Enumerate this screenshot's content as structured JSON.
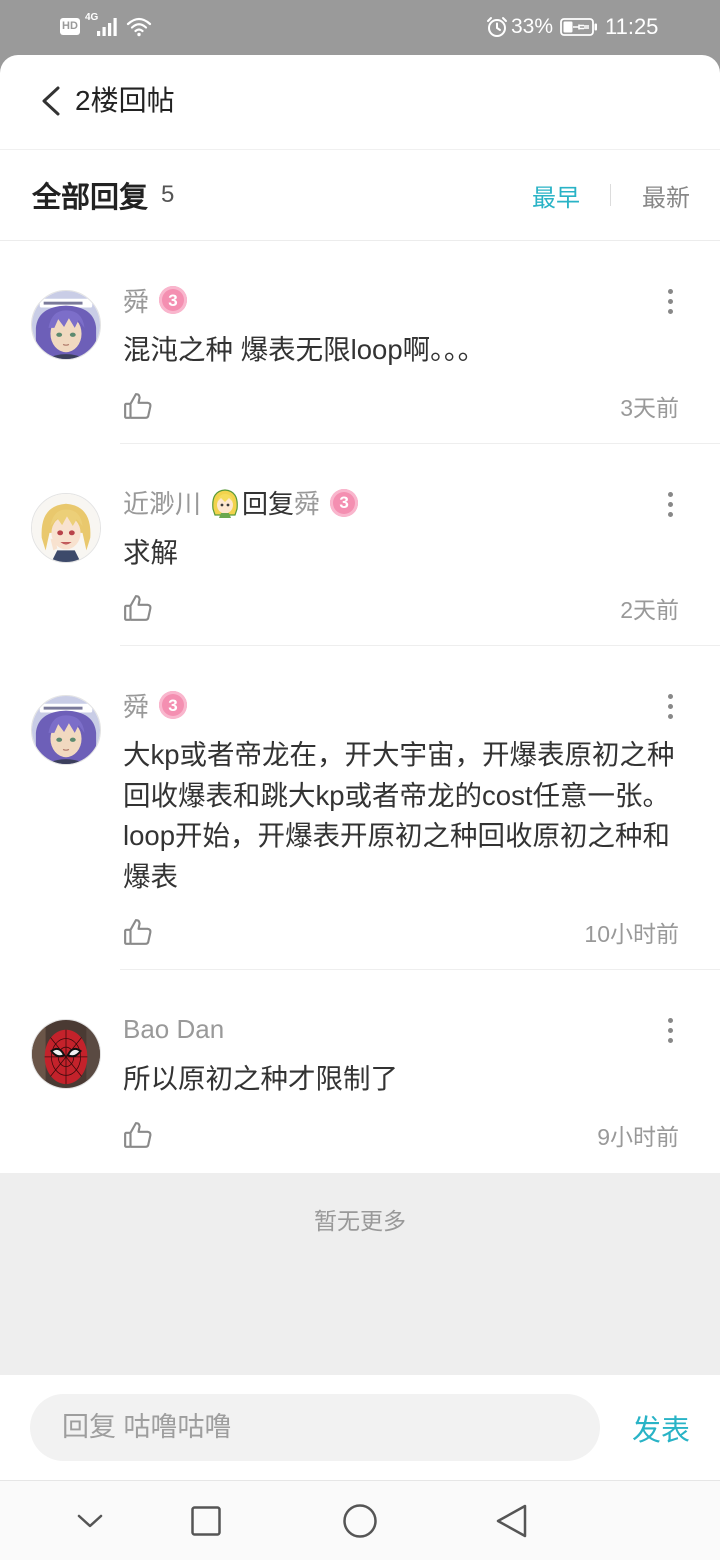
{
  "status_bar": {
    "hd_label": "HD",
    "network_label": "4G",
    "battery_percent": "33%",
    "time": "11:25",
    "icons": {
      "signal": "signal-bars-icon",
      "wifi": "wifi-icon",
      "alarm": "alarm-clock-icon",
      "battery": "battery-charging-icon"
    }
  },
  "header": {
    "title": "2楼回帖",
    "back_icon": "chevron-left-icon"
  },
  "replies_section": {
    "title": "全部回复",
    "count": "5",
    "sort_options": [
      {
        "label": "最早",
        "active": true
      },
      {
        "label": "最新",
        "active": false
      }
    ]
  },
  "replies": [
    {
      "author": "舜",
      "level": "3",
      "avatar": "anime-avatar-icon",
      "content": [
        "混沌之种 爆表无限loop啊。。。"
      ],
      "time": "3天前"
    },
    {
      "author": "近渺川",
      "author_emblem": "chibi-emblem-icon",
      "reply_label": "回复",
      "reply_to": "舜",
      "level": "3",
      "avatar": "anime-girl-avatar-icon",
      "content": [
        "求解"
      ],
      "time": "2天前"
    },
    {
      "author": "舜",
      "level": "3",
      "avatar": "anime-avatar-icon",
      "content": [
        "大kp或者帝龙在，开大宇宙，开爆表原初之种",
        "回收爆表和跳大kp或者帝龙的cost任意一张。",
        "loop开始，开爆表开原初之种回收原初之种和",
        "爆表"
      ],
      "time": "10小时前"
    },
    {
      "author": "Bao Dan",
      "avatar": "spiderman-avatar-icon",
      "content": [
        "所以原初之种才限制了"
      ],
      "time": "9小时前"
    }
  ],
  "reply_actions": {
    "like_icon": "thumbs-up-icon",
    "more_icon": "more-vertical-icon"
  },
  "list_end_text": "暂无更多",
  "reply_bar": {
    "placeholder": "回复 咕噜咕噜",
    "submit_label": "发表"
  },
  "nav_bar": {
    "icons": [
      "chevron-down-icon",
      "recents-square-icon",
      "home-circle-icon",
      "back-triangle-icon"
    ]
  },
  "colors": {
    "accent": "#29b3c6",
    "status_bar_bg": "#9a9a9a",
    "text_primary": "#333333",
    "text_secondary": "#999999",
    "level_badge": "#f48fb1",
    "list_end_bg": "#eeeeee"
  }
}
